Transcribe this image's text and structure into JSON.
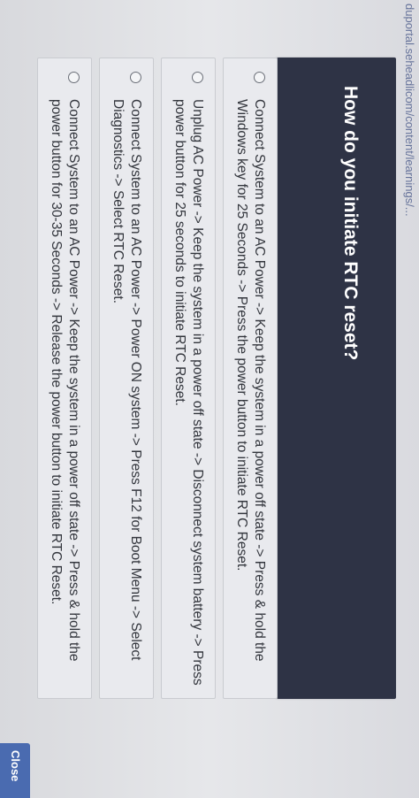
{
  "browser": {
    "url_fragment": "duportal.seheadlicom/content/learnings/..."
  },
  "question": {
    "text": "How do you initiate RTC reset?"
  },
  "options": [
    {
      "label": "Connect System to an AC Power -> Keep the system in a power off state -> Press & hold the Windows key for 25 Seconds -> Press the power button to initiate RTC Reset."
    },
    {
      "label": "Unplug AC Power -> Keep the system in a power off state -> Disconnect system battery -> Press power button for 25 seconds to initiate RTC Reset."
    },
    {
      "label": "Connect System to an AC Power -> Power ON system -> Press F12 for Boot Menu -> Select Diagnostics -> Select RTC Reset."
    },
    {
      "label": "Connect System to an AC Power -> Keep the system in a power off state -> Press & hold the power button for 30-35 Seconds -> Release the power button to initiate RTC Reset."
    }
  ],
  "footer": {
    "close_label": "Close"
  }
}
